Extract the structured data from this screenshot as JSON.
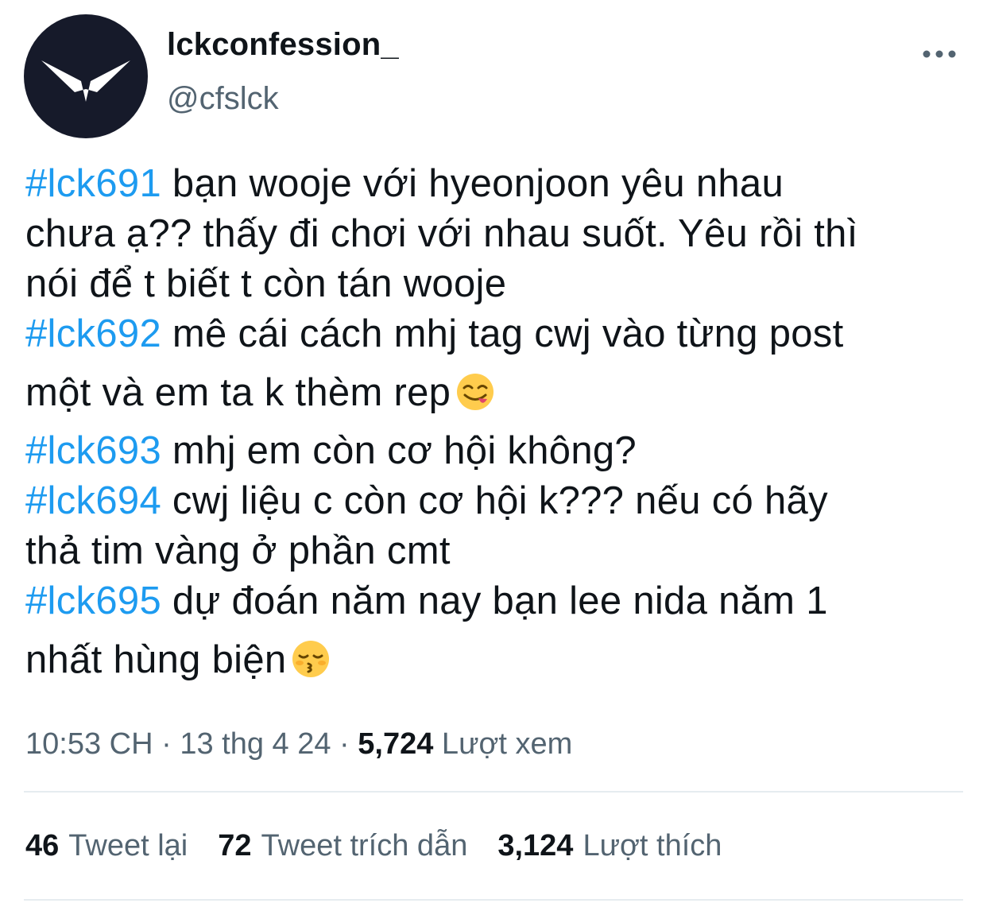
{
  "author": {
    "display_name": "lckconfession_",
    "handle": "@cfslck",
    "avatar_icon": "bird-logo-icon",
    "avatar_bg": "#161a2a"
  },
  "more_icon": "more-horizontal-icon",
  "tweet": {
    "lines": [
      {
        "hashtag": "#lck691",
        "text": " bạn wooje với hyeonjoon yêu nhau"
      },
      {
        "hashtag": "",
        "text": "chưa ạ?? thấy đi chơi với nhau suốt. Yêu rồi thì"
      },
      {
        "hashtag": "",
        "text": "nói để t biết t còn tán wooje"
      },
      {
        "hashtag": "#lck692",
        "text": " mê cái cách mhj tag cwj vào từng post"
      },
      {
        "hashtag": "",
        "text": "một và em ta k thèm rep",
        "emoji": "face-savoring-food-emoji"
      },
      {
        "hashtag": "#lck693",
        "text": " mhj em còn cơ hội không?"
      },
      {
        "hashtag": "#lck694",
        "text": " cwj liệu c còn cơ hội k??? nếu có hãy"
      },
      {
        "hashtag": "",
        "text": "thả tim vàng ở phần cmt"
      },
      {
        "hashtag": "#lck695",
        "text": " dự đoán năm nay bạn lee nida năm 1"
      },
      {
        "hashtag": "",
        "text": "nhất hùng biện",
        "emoji": "kissing-face-closed-eyes-emoji"
      }
    ]
  },
  "meta": {
    "time": "10:53 CH",
    "sep1": " · ",
    "date": "13 thg 4 24",
    "sep2": " · ",
    "views_count": "5,724",
    "views_label": " Lượt xem"
  },
  "stats": {
    "retweets": {
      "count": "46",
      "label": "Tweet lại"
    },
    "quotes": {
      "count": "72",
      "label": "Tweet trích dẫn"
    },
    "likes": {
      "count": "3,124",
      "label": "Lượt thích"
    }
  },
  "colors": {
    "hashtag": "#1d9bf0",
    "text": "#0f1419",
    "muted": "#536471",
    "divider": "#e6ecf0"
  }
}
